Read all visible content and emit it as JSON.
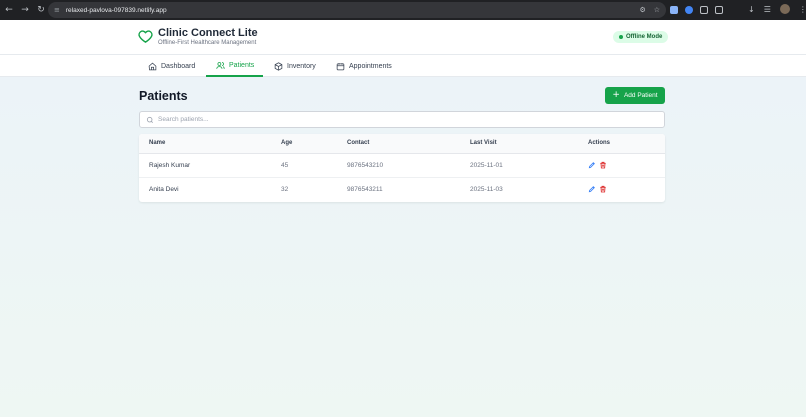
{
  "browser": {
    "url": "relaxed-pavlova-097839.netlify.app"
  },
  "app": {
    "title": "Clinic Connect Lite",
    "subtitle": "Offline-First Healthcare Management",
    "status_badge": "Offline Mode",
    "accent_color": "#16a34a"
  },
  "nav": {
    "tabs": [
      {
        "label": "Dashboard",
        "icon": "home-icon",
        "active": false
      },
      {
        "label": "Patients",
        "icon": "users-icon",
        "active": true
      },
      {
        "label": "Inventory",
        "icon": "box-icon",
        "active": false
      },
      {
        "label": "Appointments",
        "icon": "calendar-icon",
        "active": false
      }
    ]
  },
  "page": {
    "title": "Patients",
    "add_button": "Add Patient",
    "search_placeholder": "Search patients..."
  },
  "table": {
    "columns": [
      "Name",
      "Age",
      "Contact",
      "Last Visit",
      "Actions"
    ],
    "rows": [
      {
        "name": "Rajesh Kumar",
        "age": "45",
        "contact": "9876543210",
        "last_visit": "2025-11-01"
      },
      {
        "name": "Anita Devi",
        "age": "32",
        "contact": "9876543211",
        "last_visit": "2025-11-03"
      }
    ]
  }
}
